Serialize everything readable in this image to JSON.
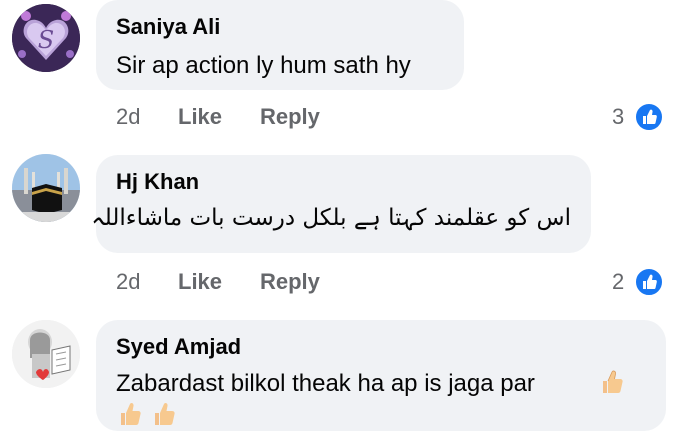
{
  "comments": [
    {
      "author": "Saniya Ali",
      "text": "Sir ap action ly hum sath hy",
      "time": "2d",
      "like_label": "Like",
      "reply_label": "Reply",
      "reactions": "3"
    },
    {
      "author": "Hj Khan",
      "text": "اس کو عقلمند کہتا ہے بلکل درست بات ماشاءاللہ",
      "time": "2d",
      "like_label": "Like",
      "reply_label": "Reply",
      "reactions": "2"
    },
    {
      "author": "Syed Amjad",
      "text": "Zabardast bilkol theak ha ap is jaga par"
    }
  ],
  "colors": {
    "bubble": "#f0f2f5",
    "meta": "#65676b",
    "like_blue": "#1877f2"
  }
}
